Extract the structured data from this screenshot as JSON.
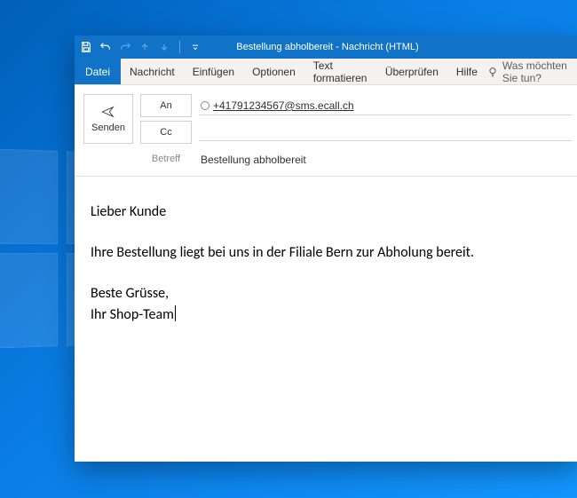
{
  "titlebar": {
    "title": "Bestellung abholbereit  -  Nachricht (HTML)"
  },
  "menu": {
    "file": "Datei",
    "message": "Nachricht",
    "insert": "Einfügen",
    "options": "Optionen",
    "format_text": "Text formatieren",
    "review": "Überprüfen",
    "help": "Hilfe",
    "tell_me": "Was möchten Sie tun?"
  },
  "compose": {
    "send": "Senden",
    "to_label": "An",
    "cc_label": "Cc",
    "subject_label": "Betreff",
    "to_value": "+41791234567@sms.ecall.ch",
    "cc_value": "",
    "subject_value": "Bestellung abholbereit"
  },
  "body": {
    "greeting": "Lieber Kunde",
    "line1": "Ihre Bestellung liegt bei uns in der Filiale Bern zur Abholung bereit.",
    "closing": "Beste Grüsse,",
    "signature": "Ihr Shop-Team"
  }
}
